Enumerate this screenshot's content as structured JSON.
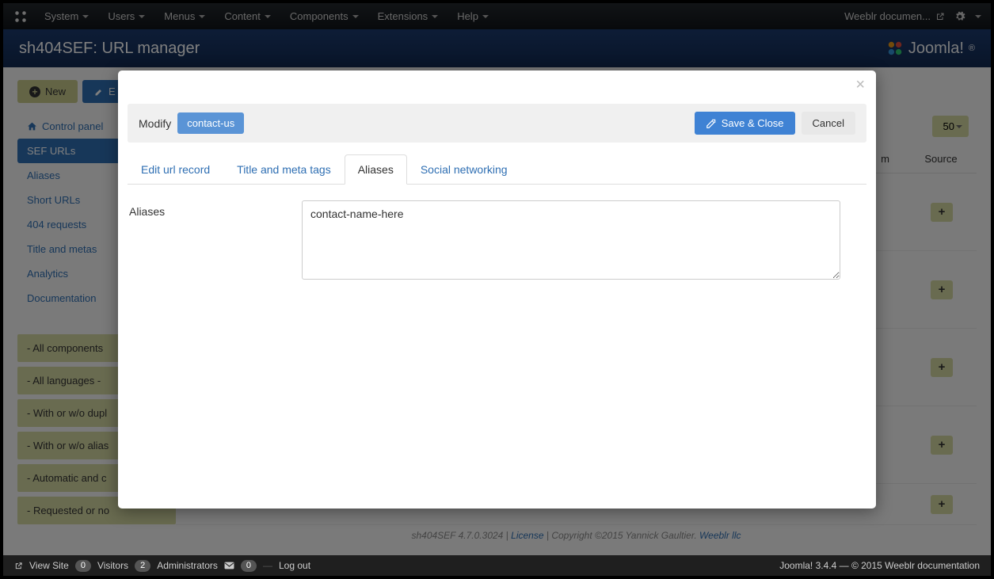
{
  "topnav": {
    "items": [
      "System",
      "Users",
      "Menus",
      "Content",
      "Components",
      "Extensions",
      "Help"
    ],
    "right_link": "Weeblr documen..."
  },
  "header": {
    "title": "sh404SEF: URL manager",
    "brand": "Joomla!"
  },
  "toolbar": {
    "new": "New",
    "edit": "E"
  },
  "sidebar": {
    "links": [
      "Control panel",
      "SEF URLs",
      "Aliases",
      "Short URLs",
      "404 requests",
      "Title and metas",
      "Analytics",
      "Documentation"
    ],
    "active_index": 1,
    "filters": [
      "- All components",
      "- All languages -",
      "- With or w/o dupl",
      "- With or w/o alias",
      "- Automatic and c",
      "- Requested or no"
    ]
  },
  "grid": {
    "page_size": "50",
    "headers": {
      "custom": "m",
      "source": "Source"
    },
    "expand": "+"
  },
  "modal": {
    "modify_label": "Modify",
    "record": "contact-us",
    "save": "Save & Close",
    "cancel": "Cancel",
    "tabs": [
      "Edit url record",
      "Title and meta tags",
      "Aliases",
      "Social networking"
    ],
    "active_tab": 2,
    "aliases_label": "Aliases",
    "aliases_value": "contact-name-here"
  },
  "footer": {
    "product": "sh404SEF 4.7.0.3024",
    "license": "License",
    "copyright": "Copyright ©2015 Yannick Gaultier.",
    "company": "Weeblr llc"
  },
  "statusbar": {
    "view_site": "View Site",
    "visitors_n": "0",
    "visitors": "Visitors",
    "admins_n": "2",
    "admins": "Administrators",
    "msgs_n": "0",
    "logout": "Log out",
    "right": "Joomla! 3.4.4 — © 2015 Weeblr documentation"
  }
}
